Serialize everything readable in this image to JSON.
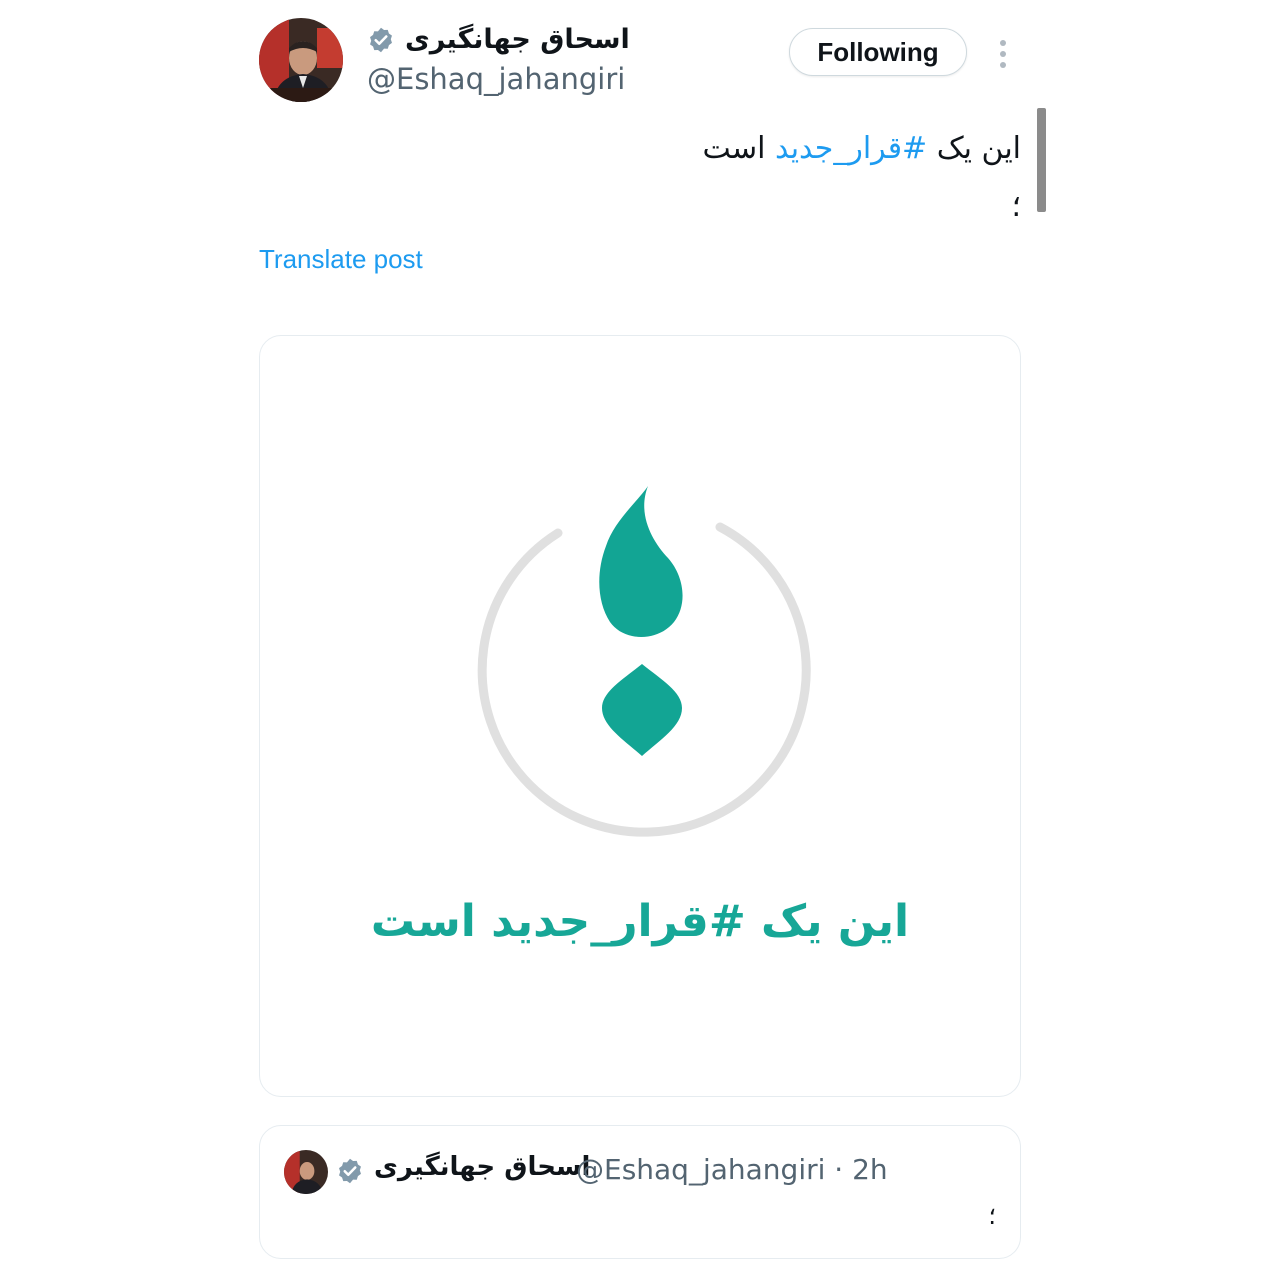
{
  "post": {
    "author_name": "اسحاق جهانگیری",
    "handle": "@Eshaq_jahangiri",
    "follow_label": "Following",
    "text_prefix": "این یک ",
    "hashtag": "#قرار_جدید",
    "text_suffix": " است",
    "text_line2": "؛",
    "translate_label": "Translate post",
    "verified_icon": "verified-badge-icon",
    "more_icon": "more-vertical-icon"
  },
  "media": {
    "caption": "این یک #قرار_جدید است",
    "accent_color": "#12a594",
    "ring_color": "#e0e0e0"
  },
  "quote": {
    "author_name": "اسحاق جهانگیری",
    "meta": "@Eshaq_jahangiri · 2h",
    "text": "؛"
  },
  "colors": {
    "link": "#1d9bf0",
    "secondary_text": "#536471",
    "border": "#e6ecf0"
  }
}
